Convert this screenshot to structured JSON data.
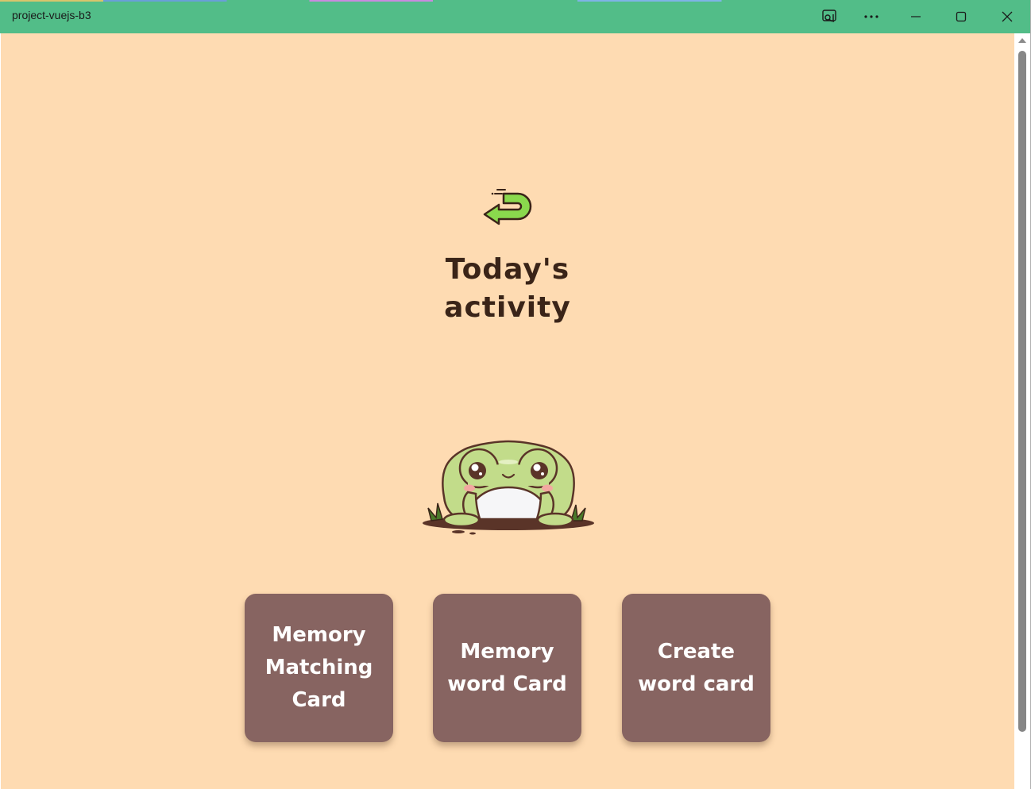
{
  "window": {
    "title": "project-vuejs-b3",
    "titlebar_color": "#52bd88"
  },
  "page": {
    "background": "#fedbb2",
    "back_icon": "back-arrow-icon",
    "heading_line1": "Today's",
    "heading_line2": "activity",
    "mascot": "frog-mascot",
    "cards": [
      {
        "line1": "Memory",
        "line2": "Matching",
        "line3": "Card"
      },
      {
        "line1": "Memory",
        "line2": "word Card"
      },
      {
        "line1": "Create",
        "line2": "word card"
      }
    ],
    "card_color": "#876461"
  }
}
